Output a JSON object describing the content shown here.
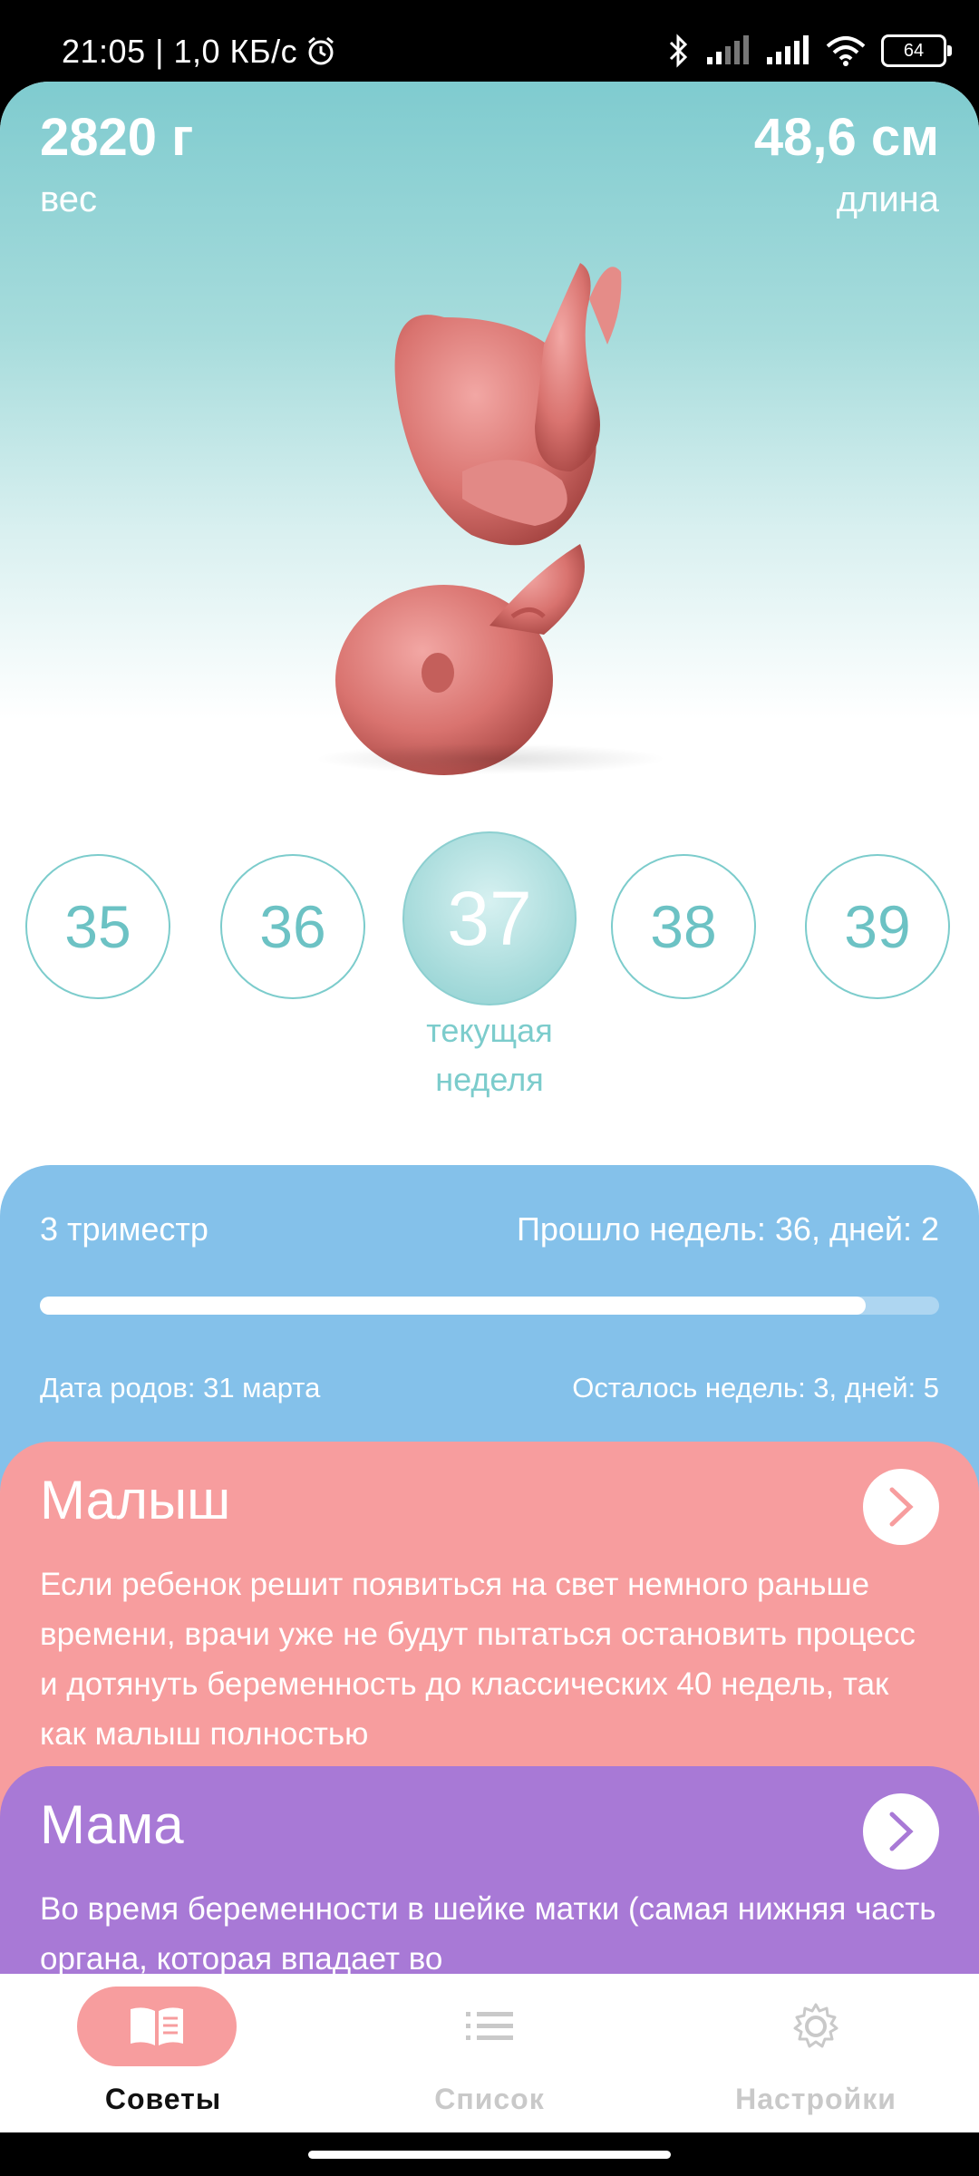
{
  "status_bar": {
    "time": "21:05 | 1,0 КБ/с",
    "battery": "64"
  },
  "hero": {
    "weight_value": "2820 г",
    "weight_label": "вес",
    "length_value": "48,6 см",
    "length_label": "длина"
  },
  "weeks": {
    "items": [
      "35",
      "36",
      "37",
      "38",
      "39"
    ],
    "current_index": 2,
    "current_label_line1": "текущая",
    "current_label_line2": "неделя"
  },
  "trimester": {
    "title": "3 триместр",
    "passed": "Прошло недель: 36, дней: 2",
    "progress": 0.918,
    "due_date": "Дата родов: 31 марта",
    "remaining": "Осталось недель: 3, дней: 5"
  },
  "cards": {
    "baby": {
      "title": "Малыш",
      "text": "Если ребенок решит появиться на свет немного раньше времени, врачи уже не будут пытаться остановить процесс и дотянуть беременность до классических 40 недель, так как малыш полностью"
    },
    "mom": {
      "title": "Мама",
      "text": "Во время беременности в шейке матки (самая нижняя часть органа, которая впадает во"
    }
  },
  "bottom_nav": {
    "items": [
      {
        "label": "Советы",
        "icon": "book-icon",
        "active": true
      },
      {
        "label": "Список",
        "icon": "list-icon",
        "active": false
      },
      {
        "label": "Настройки",
        "icon": "gear-icon",
        "active": false
      }
    ]
  },
  "colors": {
    "teal": "#7ccccc",
    "blue_card": "#84c1ea",
    "pink_card": "#f79d9e",
    "purple_card": "#a879d6"
  }
}
